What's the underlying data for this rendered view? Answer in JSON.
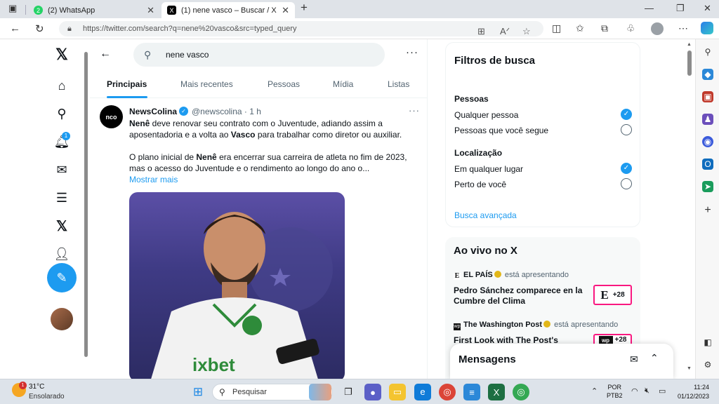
{
  "browser": {
    "tabs": [
      {
        "label": "(2) WhatsApp",
        "favicon": "2",
        "favicon_color": "#25d366"
      },
      {
        "label": "(1) nene vasco – Buscar / X",
        "favicon": "X",
        "favicon_color": "#000000"
      }
    ],
    "new_tab": "+",
    "url": "https://twitter.com/search?q=nene%20vasco&src=typed_query"
  },
  "sidebar": {
    "notification_count": "1"
  },
  "search": {
    "query": "nene vasco",
    "tabs": [
      "Principais",
      "Mais recentes",
      "Pessoas",
      "Mídia",
      "Listas"
    ],
    "active_tab": "Principais"
  },
  "tweet": {
    "author": "NewsColina",
    "handle_time": "@newscolina · 1 h",
    "avatar_text": "nco",
    "p1_bold1": "Nenê",
    "p1_text1": " deve renovar seu contrato com o Juventude, adiando assim a aposentadoria e a volta ao ",
    "p1_bold2": "Vasco",
    "p1_text2": " para trabalhar como diretor ou auxiliar.",
    "p2_text1": "O plano inicial de ",
    "p2_bold1": "Nenê",
    "p2_text2": " era encerrar sua carreira de atleta no fim de 2023, mas o acesso do Juventude e o rendimento ao longo do ano o...",
    "show_more": "Mostrar mais"
  },
  "filters": {
    "title": "Filtros de busca",
    "people_heading": "Pessoas",
    "people_options": [
      "Qualquer pessoa",
      "Pessoas que você segue"
    ],
    "people_selected": 0,
    "location_heading": "Localização",
    "location_options": [
      "Em qualquer lugar",
      "Perto de você"
    ],
    "location_selected": 0,
    "advanced": "Busca avançada"
  },
  "live": {
    "title": "Ao vivo no X",
    "items": [
      {
        "source": "EL PAÍS",
        "action": "está apresentando",
        "title": "Pedro Sánchez comparece en la Cumbre del Clima",
        "badge": "+28",
        "badge_letter": "E"
      },
      {
        "source": "The Washington Post",
        "action": "está apresentando",
        "title": "First Look with The Post's",
        "badge": "+28",
        "badge_letter": "wp"
      }
    ]
  },
  "messages": {
    "title": "Mensagens"
  },
  "taskbar": {
    "weather_temp": "31°C",
    "weather_desc": "Ensolarado",
    "weather_badge": "1",
    "search_placeholder": "Pesquisar",
    "lang_1": "POR",
    "lang_2": "PTB2",
    "time": "11:24",
    "date": "01/12/2023"
  },
  "colors": {
    "accent": "#1d9bf0",
    "live_badge_border": "#f91880"
  }
}
